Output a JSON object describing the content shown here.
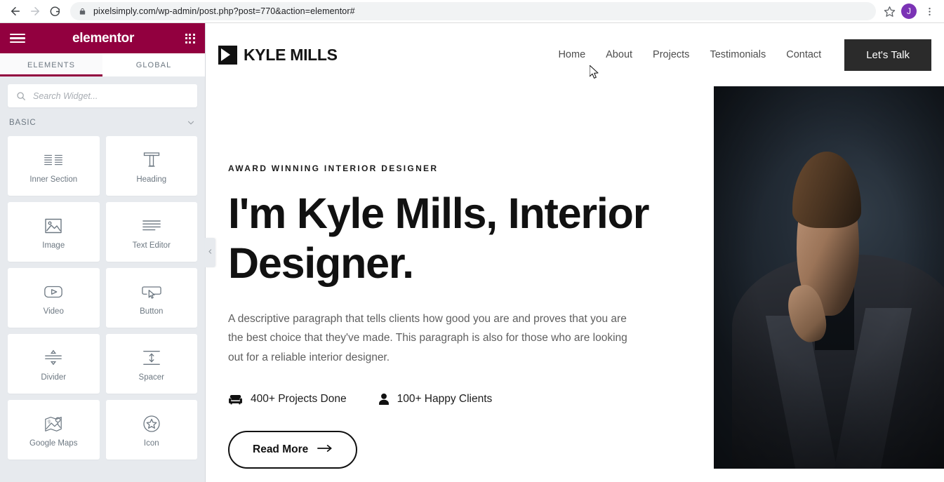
{
  "browser": {
    "url": "pixelsimply.com/wp-admin/post.php?post=770&action=elementor#",
    "back_label": "Back",
    "forward_label": "Forward",
    "reload_label": "Reload",
    "lock_icon": "lock-icon",
    "bookmark_icon": "star-icon",
    "avatar_initial": "J",
    "menu_icon": "three-dot-menu-icon"
  },
  "panel": {
    "logo_text": "elementor",
    "menu_icon": "hamburger-icon",
    "apps_icon": "apps-grid-icon",
    "brand_color": "#92003f",
    "background_color": "#e7eaee",
    "tabs": [
      {
        "label": "ELEMENTS",
        "active": true
      },
      {
        "label": "GLOBAL",
        "active": false
      }
    ],
    "search": {
      "placeholder": "Search Widget...",
      "value": "",
      "icon": "search-icon"
    },
    "category": {
      "label": "BASIC",
      "chevron": "chevron-down-icon",
      "expanded": true
    },
    "widgets": [
      {
        "label": "Inner Section",
        "icon": "columns-icon"
      },
      {
        "label": "Heading",
        "icon": "heading-t-icon"
      },
      {
        "label": "Image",
        "icon": "image-icon"
      },
      {
        "label": "Text Editor",
        "icon": "text-lines-icon"
      },
      {
        "label": "Video",
        "icon": "play-icon"
      },
      {
        "label": "Button",
        "icon": "button-cursor-icon"
      },
      {
        "label": "Divider",
        "icon": "divider-icon"
      },
      {
        "label": "Spacer",
        "icon": "spacer-icon"
      },
      {
        "label": "Google Maps",
        "icon": "map-pin-icon"
      },
      {
        "label": "Icon",
        "icon": "star-circle-icon"
      }
    ],
    "collapse_icon": "chevron-left-icon"
  },
  "site": {
    "brand": {
      "name": "KYLE MILLS",
      "mark": "triangle-logo-mark"
    },
    "nav": [
      {
        "label": "Home"
      },
      {
        "label": "About"
      },
      {
        "label": "Projects"
      },
      {
        "label": "Testimonials"
      },
      {
        "label": "Contact"
      }
    ],
    "cta": {
      "label": "Let's Talk",
      "background": "#2b2b2b"
    },
    "hero": {
      "eyebrow": "AWARD WINNING INTERIOR DESIGNER",
      "title": "I'm Kyle Mills, Interior Designer.",
      "description": "A descriptive paragraph that tells clients how good you are and proves that you are the best choice that they've made. This paragraph is also for those who are looking out for a reliable interior designer.",
      "stats": [
        {
          "value": "400+ Projects Done",
          "icon": "sofa-icon"
        },
        {
          "value": "100+ Happy Clients",
          "icon": "person-icon"
        }
      ],
      "button": {
        "label": "Read More",
        "arrow_icon": "arrow-right-icon"
      },
      "photo_alt": "portrait-of-man-in-dark-suit"
    }
  }
}
